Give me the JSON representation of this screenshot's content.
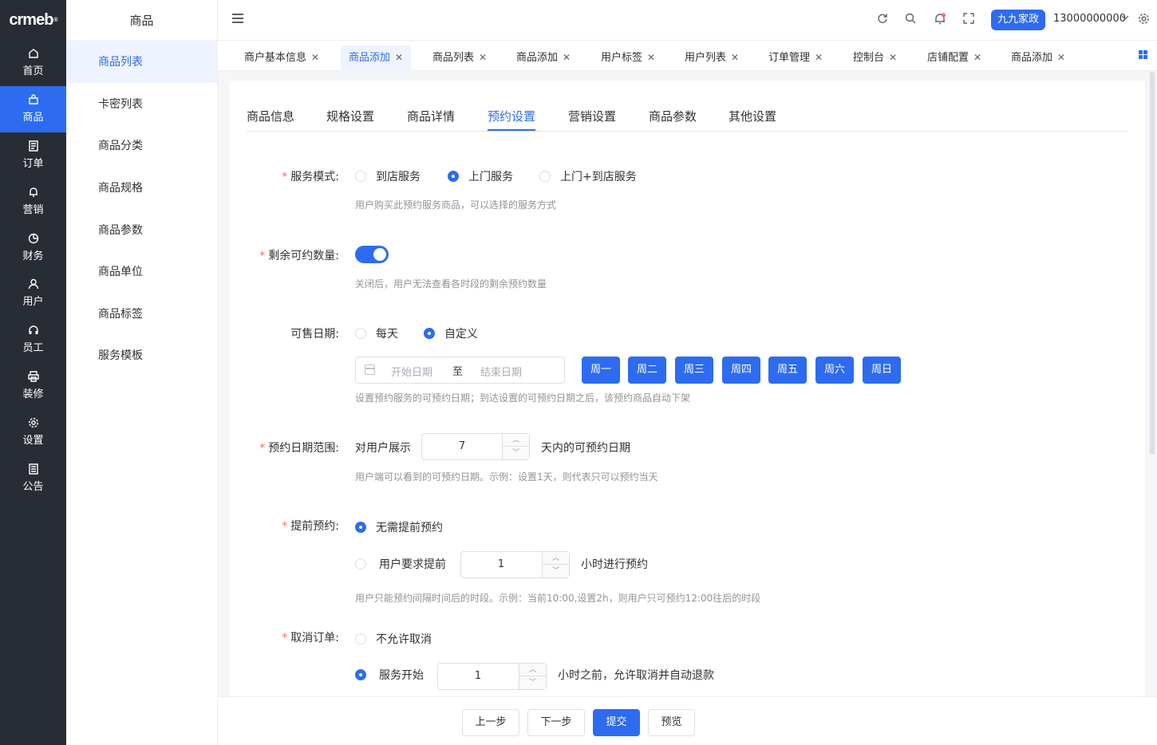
{
  "logo": {
    "text": "crmeb",
    "mark": "®"
  },
  "nav": {
    "items": [
      {
        "label": "首页",
        "icon": "home-icon"
      },
      {
        "label": "商品",
        "icon": "bag-icon",
        "active": true
      },
      {
        "label": "订单",
        "icon": "document-icon"
      },
      {
        "label": "营销",
        "icon": "bell-icon"
      },
      {
        "label": "财务",
        "icon": "pie-chart-icon"
      },
      {
        "label": "用户",
        "icon": "user-icon"
      },
      {
        "label": "员工",
        "icon": "headset-icon"
      },
      {
        "label": "装修",
        "icon": "printer-icon"
      },
      {
        "label": "设置",
        "icon": "gear-icon"
      },
      {
        "label": "公告",
        "icon": "notice-icon"
      }
    ]
  },
  "submenu": {
    "title": "商品",
    "items": [
      "商品列表",
      "卡密列表",
      "商品分类",
      "商品规格",
      "商品参数",
      "商品单位",
      "商品标签",
      "服务模板"
    ]
  },
  "header": {
    "shop_name": "九九家政",
    "phone": "13000000000",
    "icons": [
      "refresh-icon",
      "search-icon",
      "bell-icon",
      "fullscreen-icon",
      "gear-icon"
    ]
  },
  "tabs": [
    "商户基本信息",
    "商品添加",
    "商品列表",
    "商品添加",
    "用户标签",
    "用户列表",
    "订单管理",
    "控制台",
    "店铺配置",
    "商品添加"
  ],
  "form_tabs": [
    "商品信息",
    "规格设置",
    "商品详情",
    "预约设置",
    "营销设置",
    "商品参数",
    "其他设置"
  ],
  "form": {
    "service_mode": {
      "label": "服务模式:",
      "options": [
        "到店服务",
        "上门服务",
        "上门+到店服务"
      ],
      "selected": 1,
      "hint": "用户购买此预约服务商品，可以选择的服务方式"
    },
    "remaining": {
      "label": "剩余可约数量:",
      "on": true,
      "hint": "关闭后，用户无法查看各时段的剩余预约数量"
    },
    "sale_date": {
      "label": "可售日期:",
      "options": [
        "每天",
        "自定义"
      ],
      "selected": 1,
      "start_placeholder": "开始日期",
      "separator": "至",
      "end_placeholder": "结束日期",
      "days": [
        "周一",
        "周二",
        "周三",
        "周四",
        "周五",
        "周六",
        "周日"
      ],
      "hint": "设置预约服务的可预约日期；到达设置的可预约日期之后，该预约商品自动下架"
    },
    "date_range": {
      "label": "预约日期范围:",
      "prefix": "对用户展示",
      "value": "7",
      "suffix": "天内的可预约日期",
      "hint": "用户端可以看到的可预约日期。示例：设置1天，则代表只可以预约当天"
    },
    "advance": {
      "label": "提前预约:",
      "option_none": "无需提前预约",
      "option_require": "用户要求提前",
      "value": "1",
      "suffix": "小时进行预约",
      "hint": "用户只能预约间隔时间后的时段。示例：当前10:00,设置2h，则用户只可预约12:00往后的时段"
    },
    "cancel": {
      "label": "取消订单:",
      "option_no": "不允许取消",
      "option_yes": "服务开始",
      "value": "1",
      "suffix": "小时之前，允许取消并自动退款"
    }
  },
  "footer": {
    "prev": "上一步",
    "next": "下一步",
    "submit": "提交",
    "preview": "预览"
  }
}
